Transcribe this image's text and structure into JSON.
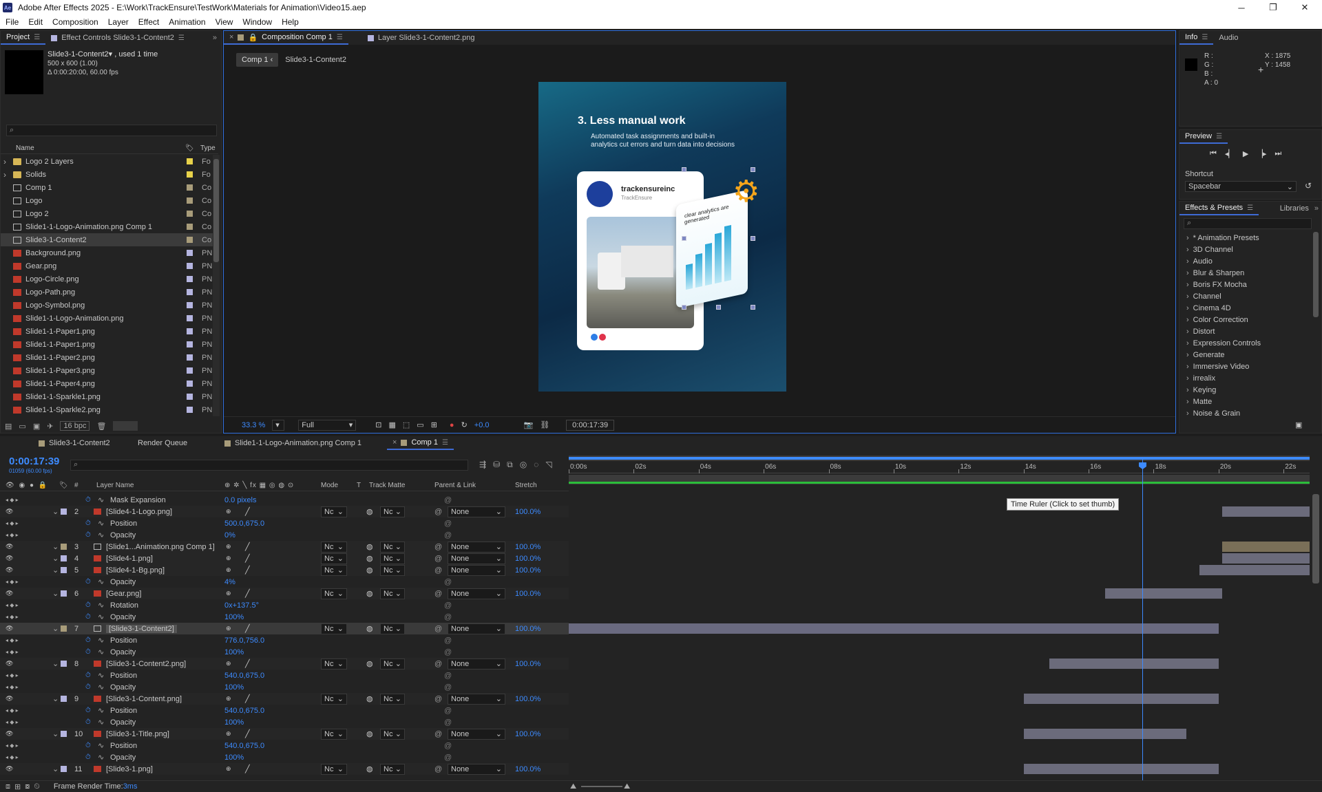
{
  "window": {
    "title": "Adobe After Effects 2025 - E:\\Work\\TrackEnsure\\TestWork\\Materials for Animation\\Video15.aep",
    "minimize": "─",
    "maximize": "❐",
    "close": "✕"
  },
  "menu": [
    "File",
    "Edit",
    "Composition",
    "Layer",
    "Effect",
    "Animation",
    "View",
    "Window",
    "Help"
  ],
  "project": {
    "tab_project": "Project",
    "tab_effect_controls": "Effect Controls Slide3-1-Content2",
    "item_name": "Slide3-1-Content2▾ , used 1 time",
    "item_size": "500 x 600 (1.00)",
    "item_duration": "Δ 0:00:20:00, 60.00 fps",
    "col_name": "Name",
    "col_type": "Type",
    "items": [
      {
        "name": "Logo 2 Layers",
        "type": "Fo",
        "kind": "folder",
        "color": "#e8d24a"
      },
      {
        "name": "Solids",
        "type": "Fo",
        "kind": "folder",
        "color": "#e8d24a"
      },
      {
        "name": "Comp 1",
        "type": "Co",
        "kind": "comp",
        "color": "#a89c7a"
      },
      {
        "name": "Logo",
        "type": "Co",
        "kind": "comp",
        "color": "#a89c7a"
      },
      {
        "name": "Logo 2",
        "type": "Co",
        "kind": "comp",
        "color": "#a89c7a"
      },
      {
        "name": "Slide1-1-Logo-Animation.png Comp 1",
        "type": "Co",
        "kind": "comp",
        "color": "#a89c7a"
      },
      {
        "name": "Slide3-1-Content2",
        "type": "Co",
        "kind": "comp",
        "color": "#a89c7a"
      },
      {
        "name": "Background.png",
        "type": "PN",
        "kind": "png",
        "color": "#b5b5e0"
      },
      {
        "name": "Gear.png",
        "type": "PN",
        "kind": "png",
        "color": "#b5b5e0"
      },
      {
        "name": "Logo-Circle.png",
        "type": "PN",
        "kind": "png",
        "color": "#b5b5e0"
      },
      {
        "name": "Logo-Path.png",
        "type": "PN",
        "kind": "png",
        "color": "#b5b5e0"
      },
      {
        "name": "Logo-Symbol.png",
        "type": "PN",
        "kind": "png",
        "color": "#b5b5e0"
      },
      {
        "name": "Slide1-1-Logo-Animation.png",
        "type": "PN",
        "kind": "png",
        "color": "#b5b5e0"
      },
      {
        "name": "Slide1-1-Paper1.png",
        "type": "PN",
        "kind": "png",
        "color": "#b5b5e0"
      },
      {
        "name": "Slide1-1-Paper1.png",
        "type": "PN",
        "kind": "png",
        "color": "#b5b5e0"
      },
      {
        "name": "Slide1-1-Paper2.png",
        "type": "PN",
        "kind": "png",
        "color": "#b5b5e0"
      },
      {
        "name": "Slide1-1-Paper3.png",
        "type": "PN",
        "kind": "png",
        "color": "#b5b5e0"
      },
      {
        "name": "Slide1-1-Paper4.png",
        "type": "PN",
        "kind": "png",
        "color": "#b5b5e0"
      },
      {
        "name": "Slide1-1-Sparkle1.png",
        "type": "PN",
        "kind": "png",
        "color": "#b5b5e0"
      },
      {
        "name": "Slide1-1-Sparkle2.png",
        "type": "PN",
        "kind": "png",
        "color": "#b5b5e0"
      }
    ],
    "bpc": "16 bpc"
  },
  "comp_panel": {
    "tab_comp": "Composition Comp 1",
    "tab_layer": "Layer Slide3-1-Content2.png",
    "crumb_1": "Comp 1",
    "crumb_2": "Slide3-1-Content2",
    "zoom": "33.3 %",
    "resolution": "Full",
    "exposure": "+0.0",
    "timecode": "0:00:17:39"
  },
  "slide": {
    "heading": "3. Less manual work",
    "subtext_1": "Automated task assignments and built-in",
    "subtext_2": "analytics cut errors and turn data into decisions",
    "brand": "trackensureinc",
    "brand_sub": "TrackEnsure",
    "card2_text": "clear analytics are generated",
    "bars": [
      0.45,
      0.6,
      0.75,
      0.9,
      1.0
    ]
  },
  "info": {
    "tab_info": "Info",
    "tab_audio": "Audio",
    "r": "R :",
    "g": "G :",
    "b": "B :",
    "a": "A :  0",
    "x": "X : 1875",
    "y": "Y : 1458"
  },
  "preview": {
    "title": "Preview",
    "shortcut_label": "Shortcut",
    "shortcut_value": "Spacebar"
  },
  "effects": {
    "tab": "Effects & Presets",
    "tab_libraries": "Libraries",
    "items": [
      "* Animation Presets",
      "3D Channel",
      "Audio",
      "Blur & Sharpen",
      "Boris FX Mocha",
      "Channel",
      "Cinema 4D",
      "Color Correction",
      "Distort",
      "Expression Controls",
      "Generate",
      "Immersive Video",
      "irrealix",
      "Keying",
      "Matte",
      "Noise & Grain"
    ]
  },
  "timeline": {
    "tabs": [
      "Slide3-1-Content2",
      "Render Queue",
      "Slide1-1-Logo-Animation.png Comp 1",
      "Comp 1"
    ],
    "timecode": "0:00:17:39",
    "frames": "01059 (60.00 fps)",
    "col_layer_name": "Layer Name",
    "col_mode": "Mode",
    "col_t": "T",
    "col_track_matte": "Track Matte",
    "col_parent": "Parent & Link",
    "col_stretch": "Stretch",
    "ruler": [
      "0:00s",
      "02s",
      "04s",
      "06s",
      "08s",
      "10s",
      "12s",
      "14s",
      "16s",
      "18s",
      "20s",
      "22s"
    ],
    "tooltip": "Time Ruler (Click to set thumb)",
    "frame_render": "Frame Render Time: ",
    "frame_render_value": "3ms",
    "playhead_time_s": 17.65,
    "rows": [
      {
        "type": "prop",
        "name": "Mask Expansion",
        "value": "0.0 pixels"
      },
      {
        "type": "layer",
        "num": "2",
        "name": "[Slide4-1-Logo.png]",
        "color": "#b5b5e0",
        "mode": "Nc",
        "matte": "Nc",
        "parent": "None",
        "stretch": "100.0%",
        "bar_start_s": 20.1,
        "bar_end_s": 23.0
      },
      {
        "type": "prop",
        "name": "Position",
        "value": "500.0,675.0"
      },
      {
        "type": "prop",
        "name": "Opacity",
        "value": "0%"
      },
      {
        "type": "layer",
        "num": "3",
        "name": "[Slide1...Animation.png Comp 1]",
        "color": "#a89c7a",
        "mode": "Nc",
        "matte": "Nc",
        "parent": "None",
        "stretch": "100.0%",
        "bar_start_s": 20.1,
        "bar_end_s": 23.2
      },
      {
        "type": "layer",
        "num": "4",
        "name": "[Slide4-1.png]",
        "color": "#b5b5e0",
        "mode": "Nc",
        "matte": "Nc",
        "parent": "None",
        "stretch": "100.0%",
        "bar_start_s": 20.1,
        "bar_end_s": 23.0
      },
      {
        "type": "layer",
        "num": "5",
        "name": "[Slide4-1-Bg.png]",
        "color": "#b5b5e0",
        "mode": "Nc",
        "matte": "Nc",
        "parent": "None",
        "stretch": "100.0%",
        "bar_start_s": 19.4,
        "bar_end_s": 23.0
      },
      {
        "type": "prop",
        "name": "Opacity",
        "value": "4%"
      },
      {
        "type": "layer",
        "num": "6",
        "name": "[Gear.png]",
        "color": "#b5b5e0",
        "mode": "Nc",
        "matte": "Nc",
        "parent": "None",
        "stretch": "100.0%",
        "bar_start_s": 16.5,
        "bar_end_s": 20.1
      },
      {
        "type": "prop",
        "name": "Rotation",
        "value": "0x+137.5°"
      },
      {
        "type": "prop",
        "name": "Opacity",
        "value": "100%"
      },
      {
        "type": "layer",
        "num": "7",
        "name": "[Slide3-1-Content2]",
        "color": "#a89c7a",
        "mode": "Nc",
        "matte": "Nc",
        "parent": "None",
        "stretch": "100.0%",
        "bar_start_s": 0.0,
        "bar_end_s": 20.0,
        "selected": true
      },
      {
        "type": "prop",
        "name": "Position",
        "value": "776.0,756.0"
      },
      {
        "type": "prop",
        "name": "Opacity",
        "value": "100%"
      },
      {
        "type": "layer",
        "num": "8",
        "name": "[Slide3-1-Content2.png]",
        "color": "#b5b5e0",
        "mode": "Nc",
        "matte": "Nc",
        "parent": "None",
        "stretch": "100.0%",
        "bar_start_s": 14.8,
        "bar_end_s": 20.0
      },
      {
        "type": "prop",
        "name": "Position",
        "value": "540.0,675.0"
      },
      {
        "type": "prop",
        "name": "Opacity",
        "value": "100%"
      },
      {
        "type": "layer",
        "num": "9",
        "name": "[Slide3-1-Content.png]",
        "color": "#b5b5e0",
        "mode": "Nc",
        "matte": "Nc",
        "parent": "None",
        "stretch": "100.0%",
        "bar_start_s": 14.0,
        "bar_end_s": 20.0
      },
      {
        "type": "prop",
        "name": "Position",
        "value": "540.0,675.0"
      },
      {
        "type": "prop",
        "name": "Opacity",
        "value": "100%"
      },
      {
        "type": "layer",
        "num": "10",
        "name": "[Slide3-1-Title.png]",
        "color": "#b5b5e0",
        "mode": "Nc",
        "matte": "Nc",
        "parent": "None",
        "stretch": "100.0%",
        "bar_start_s": 14.0,
        "bar_end_s": 19.0
      },
      {
        "type": "prop",
        "name": "Position",
        "value": "540.0,675.0"
      },
      {
        "type": "prop",
        "name": "Opacity",
        "value": "100%"
      },
      {
        "type": "layer",
        "num": "11",
        "name": "[Slide3-1.png]",
        "color": "#b5b5e0",
        "mode": "Nc",
        "matte": "Nc",
        "parent": "None",
        "stretch": "100.0%",
        "bar_start_s": 14.0,
        "bar_end_s": 20.0
      }
    ]
  },
  "colors": {
    "accent": "#3d8bff",
    "selection": "#3e6bd6",
    "panel": "#232323"
  }
}
